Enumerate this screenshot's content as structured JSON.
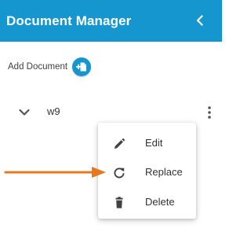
{
  "header": {
    "title": "Document Manager",
    "back_icon": "chevron-left-icon",
    "color": "#1596cf"
  },
  "add_document": {
    "label": "Add Document",
    "icon": "add-document-icon"
  },
  "documents": [
    {
      "name": "w9",
      "expand_icon": "chevron-down-icon",
      "menu_icon": "more-vert-icon"
    }
  ],
  "context_menu": {
    "items": [
      {
        "label": "Edit",
        "icon": "pencil-icon"
      },
      {
        "label": "Replace",
        "icon": "refresh-icon"
      },
      {
        "label": "Delete",
        "icon": "trash-icon"
      }
    ]
  },
  "annotation": {
    "arrow_color": "#e87722"
  }
}
